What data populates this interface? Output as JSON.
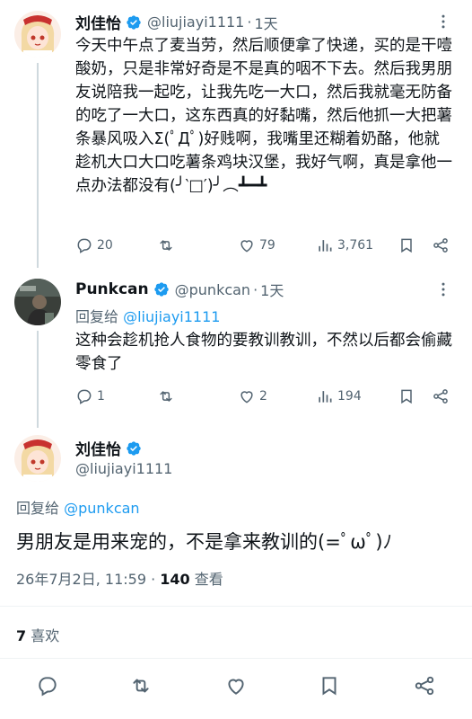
{
  "colors": {
    "accent": "#1d9bf0",
    "muted": "#536471",
    "text": "#0f1419",
    "verified": "#1d9bf0"
  },
  "tweet1": {
    "name": "刘佳怡",
    "handle": "@liujiayi1111",
    "separator": "·",
    "time": "1天",
    "text": "今天中午点了麦当劳，然后顺便拿了快递，买的是干噎酸奶，只是非常好奇是不是真的咽不下去。然后我男朋友说陪我一起吃，让我先吃一大口，然后我就毫无防备的吃了一大口，这东西真的好黏嘴，然后他抓一大把薯条暴风吸入Σ(ﾟДﾟ)好贱啊，我嘴里还糊着奶酪，他就趁机大口大口吃薯条鸡块汉堡，我好气啊，真是拿他一点办法都没有(╯‵□′)╯︵┻━┻",
    "replies": "20",
    "retweets": "",
    "likes": "79",
    "views": "3,761"
  },
  "tweet2": {
    "name": "Punkcan",
    "handle": "@punkcan",
    "separator": "·",
    "time": "1天",
    "reply_prefix": "回复给",
    "reply_handle": "@liujiayi1111",
    "text": "这种会趁机抢人食物的要教训教训，不然以后都会偷藏零食了",
    "replies": "1",
    "retweets": "",
    "likes": "2",
    "views": "194"
  },
  "main": {
    "name": "刘佳怡",
    "handle": "@liujiayi1111",
    "reply_prefix": "回复给",
    "reply_handle": "@punkcan",
    "text": "男朋友是用来宠的，不是拿来教训的(=ﾟωﾟ)ﾉ",
    "date": "26年7月2日, 11:59 · ",
    "views_count": "140",
    "views_label": " 查看",
    "likes_count": "7",
    "likes_label": " 喜欢"
  }
}
